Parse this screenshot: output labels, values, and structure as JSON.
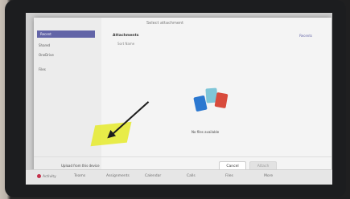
{
  "dialog": {
    "title": "Select attachment",
    "sidebar": [
      "Recent",
      "Shared",
      "OneDrive",
      "Files"
    ],
    "folder_name": "Attachments",
    "recents_label": "Recents",
    "toolbar_label": "Sort   Name",
    "empty_message": "No files available",
    "upload_label": "Upload from this device",
    "cancel_label": "Cancel",
    "attach_label": "Attach"
  },
  "nav": {
    "items": [
      "Activity",
      "Teams",
      "Assignments",
      "Calendar",
      "Calls",
      "Files",
      "More"
    ]
  }
}
